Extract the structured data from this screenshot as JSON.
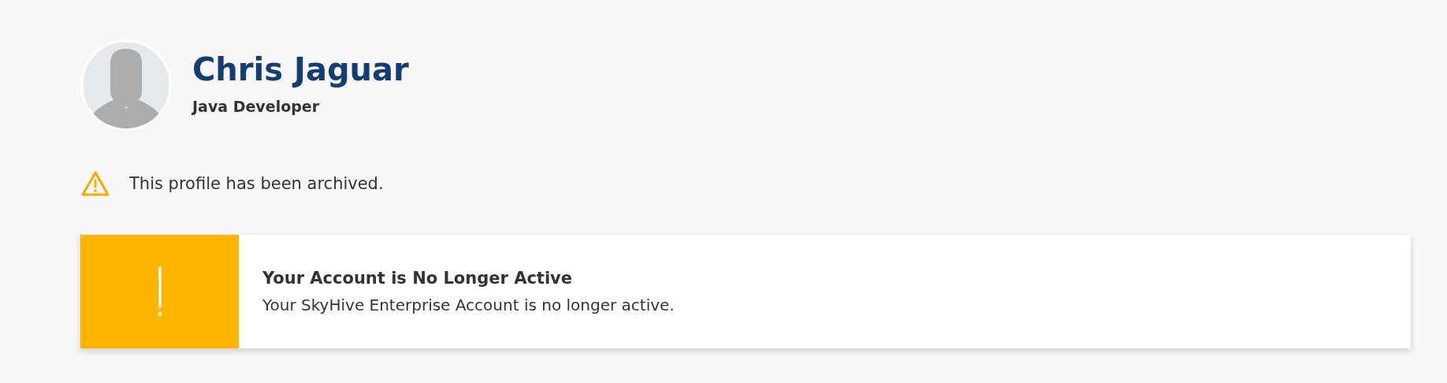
{
  "profile": {
    "name": "Chris Jaguar",
    "role": "Java Developer"
  },
  "notice": {
    "text": "This profile has been archived."
  },
  "alert": {
    "kind": "warning",
    "title": "Your Account is No Longer Active",
    "message": "Your SkyHive Enterprise Account is no longer active."
  }
}
